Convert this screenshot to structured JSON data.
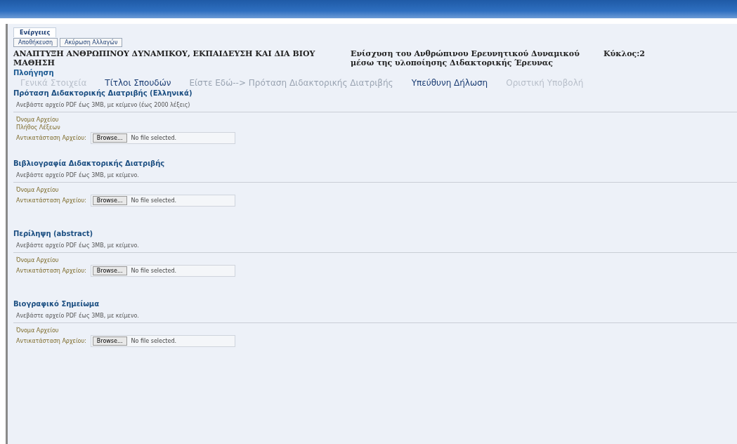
{
  "actions": {
    "label": "Ενέργειες",
    "buttons": [
      "Αποθήκευση",
      "Ακύρωση Αλλαγών"
    ]
  },
  "header": {
    "program": "ΑΝΑΠΤΥΞΗ ΑΝΘΡΩΠΙΝΟΥ ΔΥΝΑΜΙΚΟΥ, ΕΚΠΑΙΔΕΥΣΗ ΚΑΙ ΔΙΑ ΒΙΟΥ ΜΑΘΗΣΗ",
    "action": "Ενίσχυση του Ανθρώπινου Ερευνητικού Δυναμικού μέσω της υλοποίησης Διδακτορικής Έρευνας",
    "cycle": "Κύκλος:2"
  },
  "navigation": {
    "title": "Πλοήγηση",
    "steps": [
      {
        "label": "Γενικά Στοιχεία",
        "kind": "disabled"
      },
      {
        "label": "Τίτλοι Σπουδών",
        "kind": "link"
      },
      {
        "label": "Είστε Εδώ--> Πρόταση Διδακτορικής Διατριβής",
        "kind": "current"
      },
      {
        "label": "Υπεύθυνη Δήλωση",
        "kind": "link"
      },
      {
        "label": "Οριστική Υποβολή",
        "kind": "disabled"
      }
    ]
  },
  "sections": [
    {
      "title": "Πρόταση Διδακτορικής Διατριβής (Ελληνικά)",
      "hint": "Ανεβάστε αρχείο PDF έως 3MB, με κείμενο (έως 2000 λέξεις)",
      "fields": [
        {
          "kind": "label",
          "label": "Όνομα Αρχείου"
        },
        {
          "kind": "label",
          "label": "Πλήθος Λέξεων"
        },
        {
          "kind": "file",
          "label": "Αντικατάσταση Αρχείου:",
          "button": "Browse...",
          "status": "No file selected."
        }
      ]
    },
    {
      "title": "Βιβλιογραφία Διδακτορικής Διατριβής",
      "hint": "Ανεβάστε αρχείο PDF έως 3MB, με κείμενο.",
      "fields": [
        {
          "kind": "label",
          "label": "Όνομα Αρχείου"
        },
        {
          "kind": "file",
          "label": "Αντικατάσταση Αρχείου:",
          "button": "Browse...",
          "status": "No file selected."
        }
      ]
    },
    {
      "title": "Περίληψη (abstract)",
      "hint": "Ανεβάστε αρχείο PDF έως 3MB, με κείμενο.",
      "fields": [
        {
          "kind": "label",
          "label": "Όνομα Αρχείου"
        },
        {
          "kind": "file",
          "label": "Αντικατάσταση Αρχείου:",
          "button": "Browse...",
          "status": "No file selected."
        }
      ]
    },
    {
      "title": "Βιογραφικό Σημείωμα",
      "hint": "Ανεβάστε αρχείο PDF έως 3MB, με κείμενο.",
      "fields": [
        {
          "kind": "label",
          "label": "Όνομα Αρχείου"
        },
        {
          "kind": "file",
          "label": "Αντικατάσταση Αρχείου:",
          "button": "Browse...",
          "status": "No file selected."
        }
      ]
    }
  ]
}
